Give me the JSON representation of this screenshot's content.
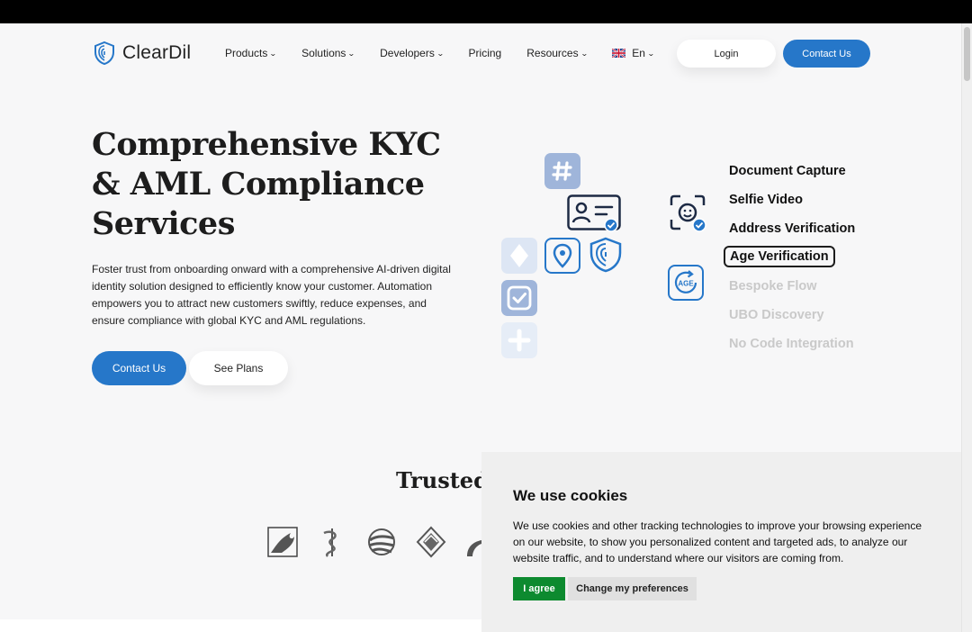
{
  "brand": {
    "name": "ClearDil"
  },
  "nav": {
    "items": [
      {
        "label": "Products",
        "has_dropdown": true
      },
      {
        "label": "Solutions",
        "has_dropdown": true
      },
      {
        "label": "Developers",
        "has_dropdown": true
      },
      {
        "label": "Pricing",
        "has_dropdown": false
      },
      {
        "label": "Resources",
        "has_dropdown": true
      }
    ],
    "language": "En",
    "login_label": "Login",
    "contact_label": "Contact Us"
  },
  "hero": {
    "title": "Comprehensive KYC & AML Compliance Services",
    "description": "Foster trust from onboarding onward with a comprehensive AI-driven digital identity solution designed to efficiently know your customer. Automation empowers you to attract new customers swiftly, reduce expenses, and ensure compliance with global KYC and AML regulations.",
    "primary_button": "Contact Us",
    "secondary_button": "See Plans"
  },
  "features": {
    "items": [
      {
        "label": "Document Capture",
        "state": "normal"
      },
      {
        "label": "Selfie Video",
        "state": "normal"
      },
      {
        "label": "Address Verification",
        "state": "normal"
      },
      {
        "label": "Age Verification",
        "state": "active"
      },
      {
        "label": "Bespoke Flow",
        "state": "dim"
      },
      {
        "label": "UBO Discovery",
        "state": "dim"
      },
      {
        "label": "No Code Integration",
        "state": "dim"
      }
    ],
    "age_icon_text": "AGE"
  },
  "trusted": {
    "title": "Trusted"
  },
  "cookie": {
    "title": "We use cookies",
    "text": "We use cookies and other tracking technologies to improve your browsing experience on our website, to show you personalized content and targeted ads, to analyze our website traffic, and to understand where our visitors are coming from.",
    "agree_label": "I agree",
    "prefs_label": "Change my preferences"
  },
  "colors": {
    "accent": "#2677c9",
    "agree_green": "#0d8a2f",
    "tile_light": "#dde6f4",
    "tile_mid": "#9fb5da"
  }
}
